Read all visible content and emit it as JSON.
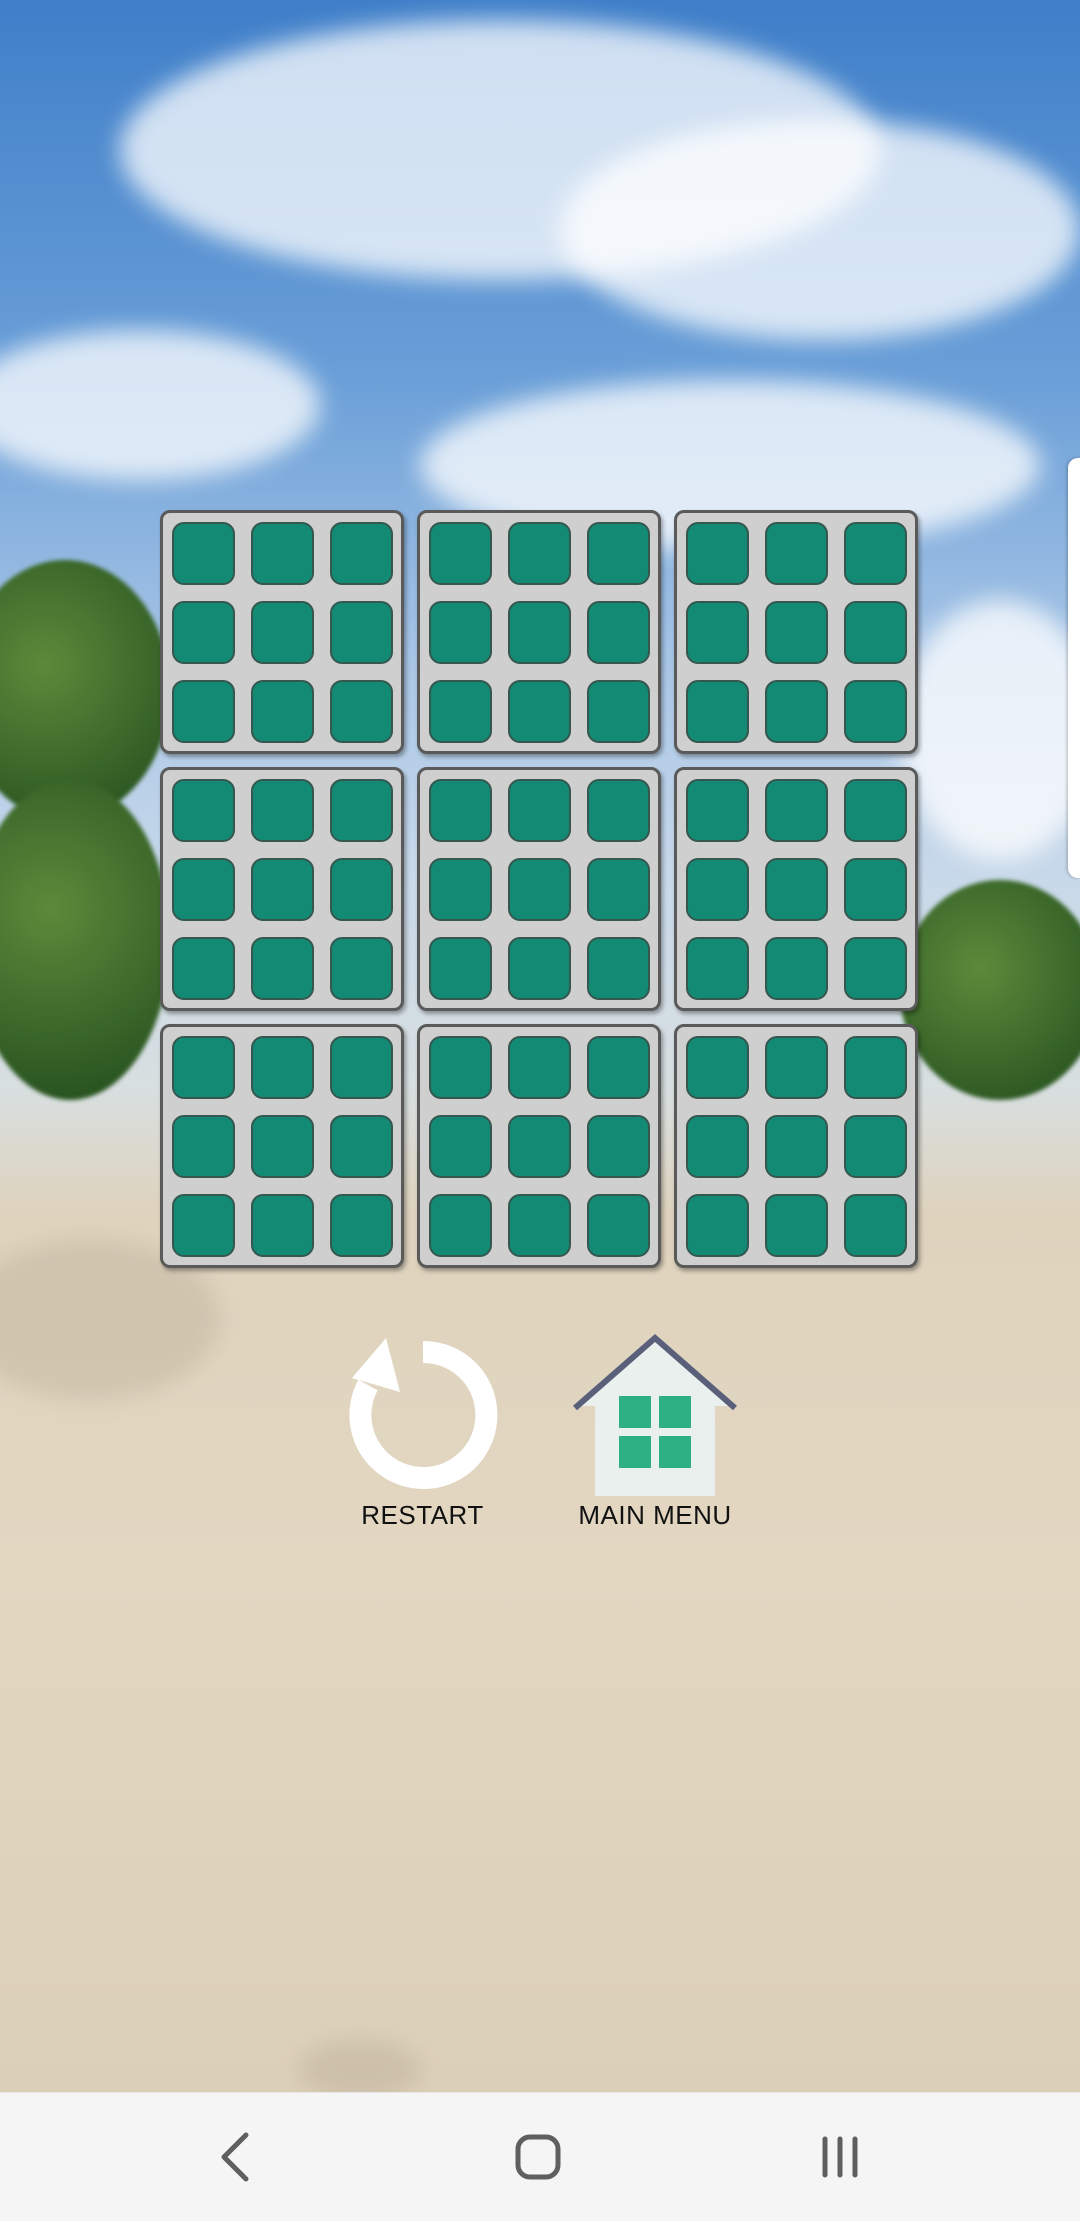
{
  "board": {
    "rows": 3,
    "cols": 3,
    "cell_grid": 3,
    "tile_color": "#138a74",
    "cell_color": "#cfcfcf"
  },
  "buttons": {
    "restart_label": "RESTART",
    "main_menu_label": "MAIN MENU"
  },
  "icons": {
    "restart": "restart-arrow-icon",
    "main_menu": "house-icon",
    "nav_back": "back-chevron-icon",
    "nav_home": "home-square-icon",
    "nav_recents": "recents-bars-icon"
  },
  "colors": {
    "house_tiles": "#2db084",
    "house_body": "#e9f0ee",
    "house_roof": "#5a5f7a"
  }
}
